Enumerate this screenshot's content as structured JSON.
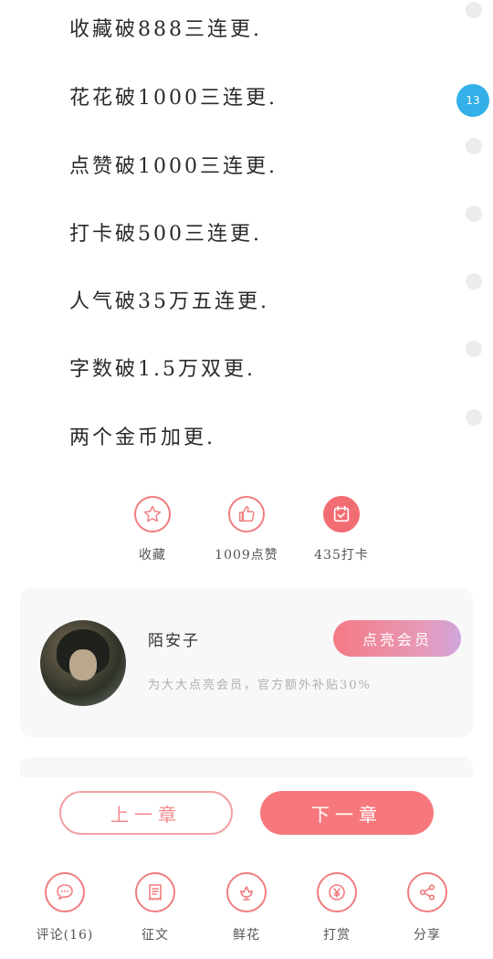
{
  "chapter_lines": [
    "收藏破888三连更.",
    "花花破1000三连更.",
    "点赞破1000三连更.",
    "打卡破500三连更.",
    "人气破35万五连更.",
    "字数破1.5万双更.",
    "两个金币加更."
  ],
  "paragraph_rail": {
    "badge": "13"
  },
  "actions": {
    "favorite": {
      "label": "收藏",
      "icon": "star-icon"
    },
    "like": {
      "label": "1009点赞",
      "icon": "thumbs-up-icon"
    },
    "checkin": {
      "label": "435打卡",
      "icon": "calendar-check-icon"
    }
  },
  "author_card": {
    "name": "陌安子",
    "vip_button": "点亮会员",
    "subtitle": "为大大点亮会员，官方额外补贴30%"
  },
  "navigation": {
    "prev": "上一章",
    "next": "下一章"
  },
  "bottom_bar": [
    {
      "label": "评论(16)",
      "icon": "comment-icon"
    },
    {
      "label": "征文",
      "icon": "essay-icon"
    },
    {
      "label": "鲜花",
      "icon": "flower-icon"
    },
    {
      "label": "打赏",
      "icon": "yen-coin-icon"
    },
    {
      "label": "分享",
      "icon": "share-icon"
    }
  ],
  "colors": {
    "accent": "#f26d73",
    "badge": "#33b0e8"
  }
}
